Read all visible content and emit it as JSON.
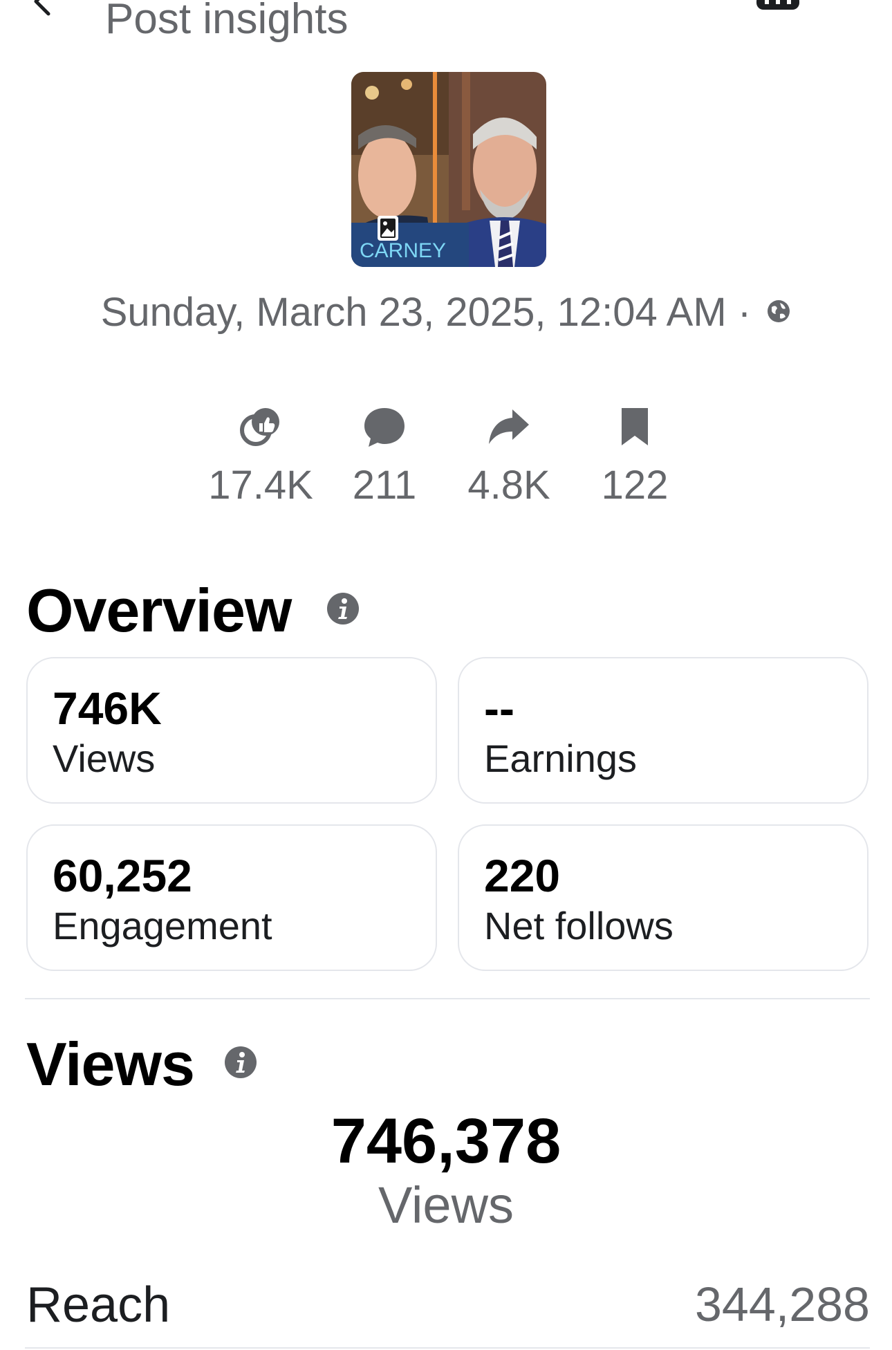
{
  "header": {
    "title": "Post insights",
    "back_icon": "back-arrow-icon",
    "more_icon": "more-icon"
  },
  "post": {
    "thumbnail_caption": "CARNEY",
    "date": "Sunday, March 23, 2025, 12:04 AM",
    "separator": "·",
    "privacy_icon": "globe-icon"
  },
  "engagement_stats": [
    {
      "icon": "reactions-icon",
      "value": "17.4K"
    },
    {
      "icon": "comment-icon",
      "value": "211"
    },
    {
      "icon": "share-icon",
      "value": "4.8K"
    },
    {
      "icon": "bookmark-icon",
      "value": "122"
    }
  ],
  "overview": {
    "title": "Overview",
    "cards": [
      {
        "value": "746K",
        "label": "Views"
      },
      {
        "value": "--",
        "label": "Earnings"
      },
      {
        "value": "60,252",
        "label": "Engagement"
      },
      {
        "value": "220",
        "label": "Net follows"
      }
    ]
  },
  "views": {
    "title": "Views",
    "total": "746,378",
    "total_label": "Views",
    "reach_label": "Reach",
    "reach_value": "344,288"
  },
  "colors": {
    "secondary_text": "#65676b",
    "border": "#e4e6eb",
    "primary_text": "#000000"
  }
}
